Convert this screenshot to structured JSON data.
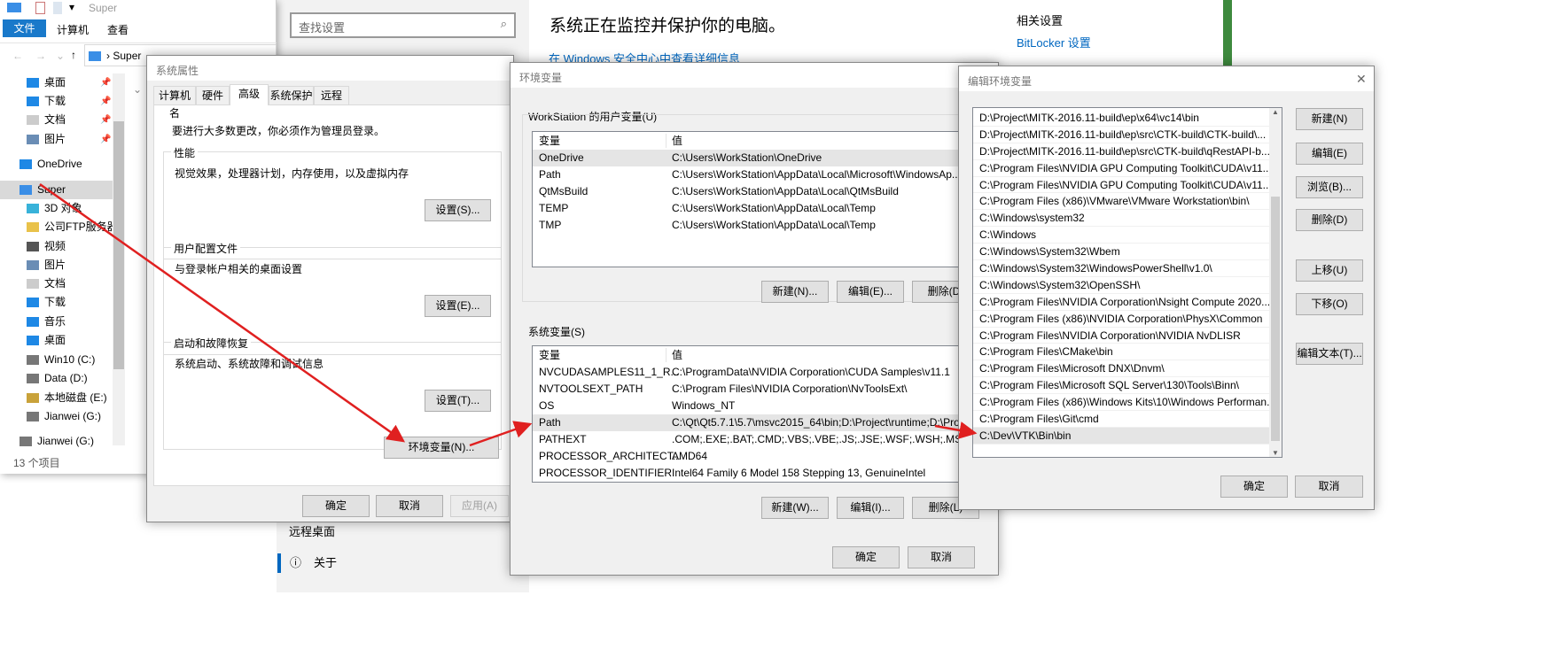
{
  "explorer": {
    "title": "Super",
    "ribbon_tabs": [
      "文件",
      "计算机",
      "查看"
    ],
    "address": "Super",
    "nav_items": [
      {
        "label": "桌面",
        "icon": "desktop-icon",
        "pinned": true
      },
      {
        "label": "下载",
        "icon": "download-icon",
        "pinned": true
      },
      {
        "label": "文档",
        "icon": "document-icon",
        "pinned": true
      },
      {
        "label": "图片",
        "icon": "picture-icon",
        "pinned": true
      },
      {
        "label": "OneDrive",
        "icon": "cloud-icon",
        "pinned": false
      },
      {
        "label": "Super",
        "icon": "computer-icon",
        "pinned": false,
        "selected": true
      },
      {
        "label": "3D 对象",
        "icon": "cube-icon"
      },
      {
        "label": "公司FTP服务器",
        "icon": "ftp-icon"
      },
      {
        "label": "视频",
        "icon": "video-icon"
      },
      {
        "label": "图片",
        "icon": "picture-icon"
      },
      {
        "label": "文档",
        "icon": "document-icon"
      },
      {
        "label": "下载",
        "icon": "download-icon"
      },
      {
        "label": "音乐",
        "icon": "music-icon"
      },
      {
        "label": "桌面",
        "icon": "desktop-icon"
      },
      {
        "label": "Win10 (C:)",
        "icon": "drive-icon"
      },
      {
        "label": "Data (D:)",
        "icon": "drive-icon"
      },
      {
        "label": "本地磁盘 (E:)",
        "icon": "locked-drive-icon"
      },
      {
        "label": "Jianwei (G:)",
        "icon": "drive-icon"
      },
      {
        "label": "Jianwei (G:)",
        "icon": "drive-icon"
      }
    ],
    "status": "13 个项目"
  },
  "settings": {
    "search_placeholder": "查找设置",
    "heading": "系统正在监控并保护你的电脑。",
    "link": "在 Windows 安全中心中查看详细信息",
    "related_title": "相关设置",
    "related_link": "BitLocker 设置",
    "nav_remote": "远程桌面",
    "nav_about": "关于",
    "accent": "#0067c0"
  },
  "sysprops": {
    "title": "系统属性",
    "tabs": [
      "计算机名",
      "硬件",
      "高级",
      "系统保护",
      "远程"
    ],
    "active_tab": "高级",
    "admin_note": "要进行大多数更改，你必须作为管理员登录。",
    "perf": {
      "label": "性能",
      "desc": "视觉效果，处理器计划，内存使用，以及虚拟内存",
      "button": "设置(S)..."
    },
    "profile": {
      "label": "用户配置文件",
      "desc": "与登录帐户相关的桌面设置",
      "button": "设置(E)..."
    },
    "startup": {
      "label": "启动和故障恢复",
      "desc": "系统启动、系统故障和调试信息",
      "button": "设置(T)..."
    },
    "env_button": "环境变量(N)...",
    "ok": "确定",
    "cancel": "取消",
    "apply": "应用(A)"
  },
  "envvars": {
    "title": "环境变量",
    "user_label": "WorkStation 的用户变量(U)",
    "col_var": "变量",
    "col_val": "值",
    "user_rows": [
      [
        "OneDrive",
        "C:\\Users\\WorkStation\\OneDrive"
      ],
      [
        "Path",
        "C:\\Users\\WorkStation\\AppData\\Local\\Microsoft\\WindowsAp..."
      ],
      [
        "QtMsBuild",
        "C:\\Users\\WorkStation\\AppData\\Local\\QtMsBuild"
      ],
      [
        "TEMP",
        "C:\\Users\\WorkStation\\AppData\\Local\\Temp"
      ],
      [
        "TMP",
        "C:\\Users\\WorkStation\\AppData\\Local\\Temp"
      ]
    ],
    "user_buttons": [
      "新建(N)...",
      "编辑(E)...",
      "删除(D)"
    ],
    "sys_label": "系统变量(S)",
    "sys_rows": [
      [
        "NVCUDASAMPLES11_1_R...",
        "C:\\ProgramData\\NVIDIA Corporation\\CUDA Samples\\v11.1"
      ],
      [
        "NVTOOLSEXT_PATH",
        "C:\\Program Files\\NVIDIA Corporation\\NvToolsExt\\"
      ],
      [
        "OS",
        "Windows_NT"
      ],
      [
        "Path",
        "C:\\Qt\\Qt5.7.1\\5.7\\msvc2015_64\\bin;D:\\Project\\runtime;D:\\Proj..."
      ],
      [
        "PATHEXT",
        ".COM;.EXE;.BAT;.CMD;.VBS;.VBE;.JS;.JSE;.WSF;.WSH;.MSC"
      ],
      [
        "PROCESSOR_ARCHITECT...",
        "AMD64"
      ],
      [
        "PROCESSOR_IDENTIFIER",
        "Intel64 Family 6 Model 158 Stepping 13, GenuineIntel"
      ]
    ],
    "sys_selected": 3,
    "sys_buttons": [
      "新建(W)...",
      "编辑(I)...",
      "删除(L)"
    ],
    "ok": "确定",
    "cancel": "取消"
  },
  "editenv": {
    "title": "编辑环境变量",
    "items": [
      "D:\\Project\\MITK-2016.11-build\\ep\\x64\\vc14\\bin",
      "D:\\Project\\MITK-2016.11-build\\ep\\src\\CTK-build\\CTK-build\\...",
      "D:\\Project\\MITK-2016.11-build\\ep\\src\\CTK-build\\qRestAPI-b...",
      "C:\\Program Files\\NVIDIA GPU Computing Toolkit\\CUDA\\v11....",
      "C:\\Program Files\\NVIDIA GPU Computing Toolkit\\CUDA\\v11....",
      "C:\\Program Files (x86)\\VMware\\VMware Workstation\\bin\\",
      "C:\\Windows\\system32",
      "C:\\Windows",
      "C:\\Windows\\System32\\Wbem",
      "C:\\Windows\\System32\\WindowsPowerShell\\v1.0\\",
      "C:\\Windows\\System32\\OpenSSH\\",
      "C:\\Program Files\\NVIDIA Corporation\\Nsight Compute 2020....",
      "C:\\Program Files (x86)\\NVIDIA Corporation\\PhysX\\Common",
      "C:\\Program Files\\NVIDIA Corporation\\NVIDIA NvDLISR",
      "C:\\Program Files\\CMake\\bin",
      "C:\\Program Files\\Microsoft DNX\\Dnvm\\",
      "C:\\Program Files\\Microsoft SQL Server\\130\\Tools\\Binn\\",
      "C:\\Program Files (x86)\\Windows Kits\\10\\Windows Performan...",
      "C:\\Program Files\\Git\\cmd",
      "C:\\Dev\\VTK\\Bin\\bin"
    ],
    "selected": 19,
    "buttons": [
      "新建(N)",
      "编辑(E)",
      "浏览(B)...",
      "删除(D)",
      "上移(U)",
      "下移(O)",
      "编辑文本(T)..."
    ],
    "ok": "确定",
    "cancel": "取消"
  },
  "annotation_color": "#e02020"
}
